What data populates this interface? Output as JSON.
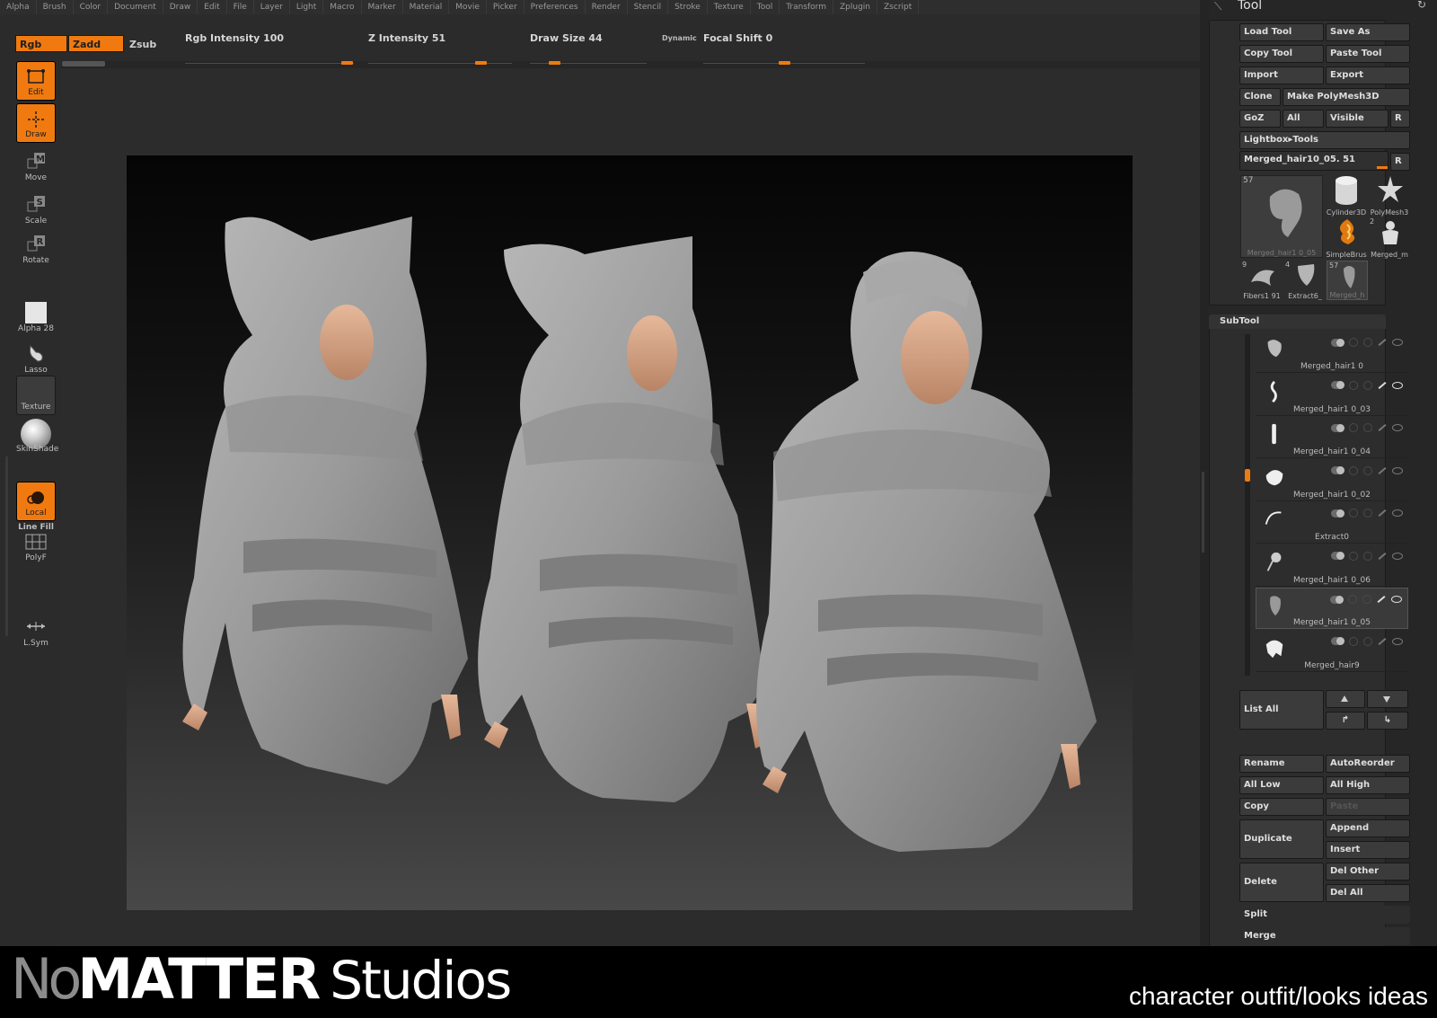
{
  "menu": [
    "Alpha",
    "Brush",
    "Color",
    "Document",
    "Draw",
    "Edit",
    "File",
    "Layer",
    "Light",
    "Macro",
    "Marker",
    "Material",
    "Movie",
    "Picker",
    "Preferences",
    "Render",
    "Stencil",
    "Stroke",
    "Texture",
    "Tool",
    "Transform",
    "Zplugin",
    "Zscript"
  ],
  "toolbar": {
    "rgb": "Rgb",
    "zadd": "Zadd",
    "zsub": "Zsub",
    "rgb_intensity_label": "Rgb  Intensity 100",
    "rgb_intensity_value": 100,
    "z_intensity_label": "Z  Intensity 51",
    "z_intensity_value": 51,
    "draw_size_label": "Draw  Size 44",
    "draw_size_value": 44,
    "dynamic_label": "Dynamic",
    "focal_shift_label": "Focal  Shift 0",
    "focal_shift_value": 0
  },
  "left_shelf": {
    "edit": "Edit",
    "draw": "Draw",
    "move": "Move",
    "scale": "Scale",
    "rotate": "Rotate",
    "alpha": "Alpha  28",
    "lasso": "Lasso",
    "texture": "Texture",
    "material": "SkinShade",
    "local": "Local",
    "line_fill": "Line Fill",
    "polyf": "PolyF",
    "lsym": "L.Sym"
  },
  "tool_panel": {
    "title": "Tool",
    "load_tool": "Load Tool",
    "save_as": "Save As",
    "copy_tool": "Copy Tool",
    "paste_tool": "Paste Tool",
    "import": "Import",
    "export": "Export",
    "clone": "Clone",
    "make_polymesh": "Make PolyMesh3D",
    "goz": "GoZ",
    "all": "All",
    "visible": "Visible",
    "r": "R",
    "lightbox": "Lightbox▸Tools",
    "current_tool": "Merged_hair10_05. 51",
    "thumbs": [
      {
        "label": "Merged_hair1 0_05",
        "count": "57"
      },
      {
        "label": "Cylinder3D",
        "count": ""
      },
      {
        "label": "PolyMesh3",
        "count": ""
      },
      {
        "label": "SimpleBrus",
        "count": ""
      },
      {
        "label": "Merged_m",
        "count": "2"
      },
      {
        "label": "Fibers1 91",
        "count": "9"
      },
      {
        "label": "Extract6_",
        "count": "4"
      },
      {
        "label": "Merged_h",
        "count": "57"
      }
    ]
  },
  "subtool": {
    "title": "SubTool",
    "items": [
      {
        "name": "Merged_hair1 0"
      },
      {
        "name": "Merged_hair1 0_03"
      },
      {
        "name": "Merged_hair1 0_04"
      },
      {
        "name": "Merged_hair1 0_02"
      },
      {
        "name": "Extract0"
      },
      {
        "name": "Merged_hair1 0_06"
      },
      {
        "name": "Merged_hair1 0_05"
      },
      {
        "name": "Merged_hair9"
      }
    ],
    "list_all": "List  All",
    "rename": "Rename",
    "autoreorder": "AutoReorder",
    "all_low": "All  Low",
    "all_high": "All  High",
    "copy": "Copy",
    "paste": "Paste",
    "duplicate": "Duplicate",
    "append": "Append",
    "insert": "Insert",
    "delete": "Delete",
    "del_other": "Del  Other",
    "del_all": "Del  All",
    "split": "Split",
    "merge": "Merge"
  },
  "footer": {
    "logo_no": "No",
    "logo_matter": "MATTER",
    "logo_studios": "Studios",
    "tagline": "character outfit/looks ideas"
  },
  "colors": {
    "accent": "#f07a10",
    "panel": "#2b2b2b",
    "button": "#3b3b3b"
  }
}
